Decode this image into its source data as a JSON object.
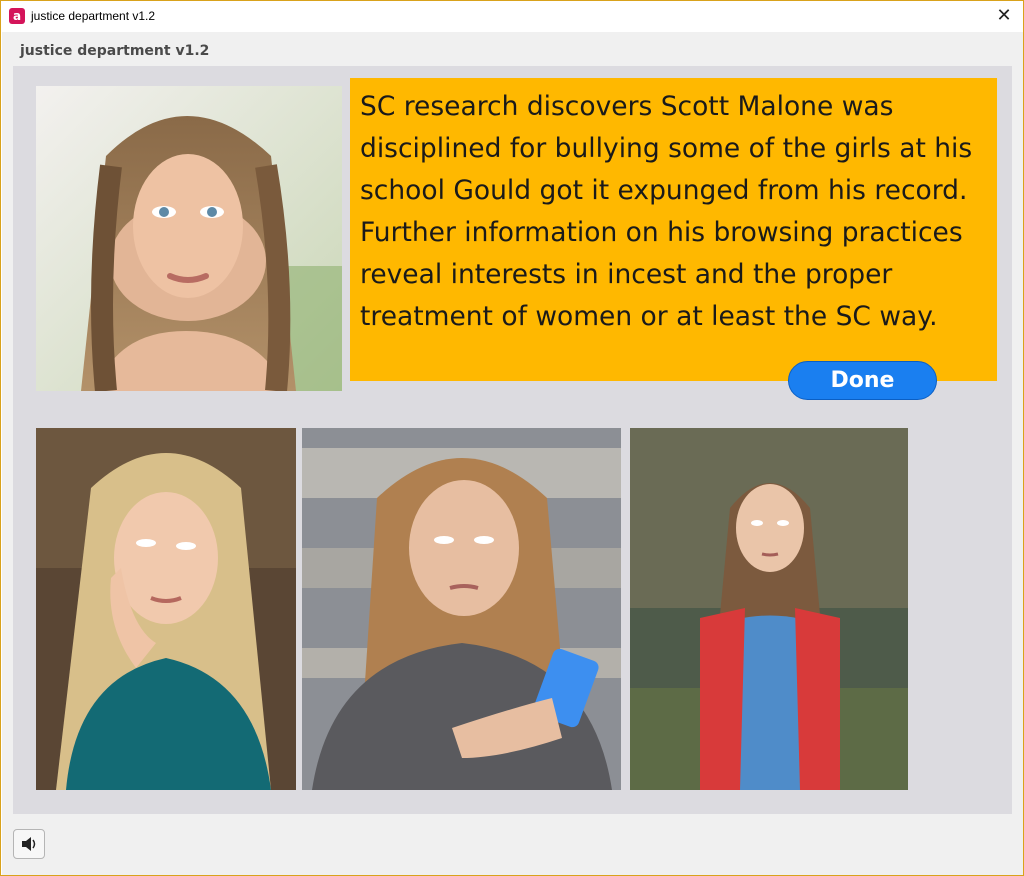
{
  "window": {
    "title": "justice department v1.2",
    "app_icon": "app-logo-icon",
    "app_icon_glyph": "a",
    "close_glyph": "✕",
    "border_color": "#d9a21b"
  },
  "header": {
    "title": "justice department v1.2"
  },
  "message": {
    "text": "SC research discovers Scott Malone was disciplined for bullying some of the girls at his school Gould got it expunged from his record.  Further information on his browsing practices reveal interests in incest and the proper treatment of women or at least the SC way.",
    "background": "#ffb800"
  },
  "done_button": {
    "label": "Done",
    "color": "#1a7ff0"
  },
  "photos": [
    {
      "name": "portrait-photo",
      "icon": "portrait-image"
    },
    {
      "name": "crying-girl-photo",
      "icon": "photo-image"
    },
    {
      "name": "girl-phone-photo",
      "icon": "photo-image"
    },
    {
      "name": "girl-red-vest-photo",
      "icon": "photo-image"
    }
  ],
  "footer": {
    "speaker_icon": "speaker-icon"
  }
}
